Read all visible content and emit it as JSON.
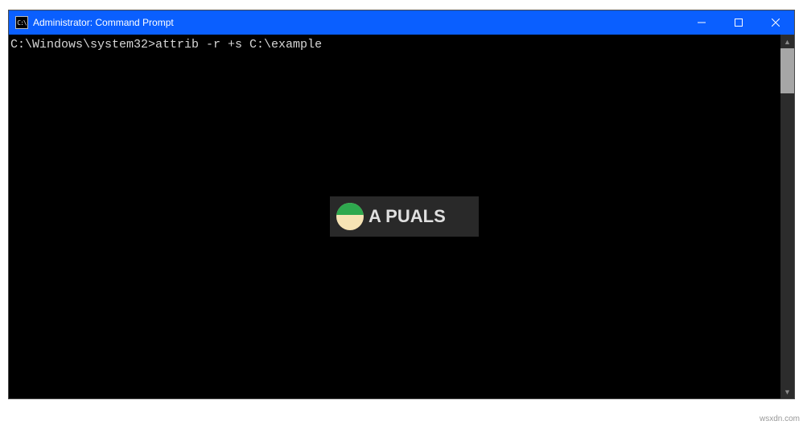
{
  "window": {
    "title": "Administrator: Command Prompt",
    "icon_label": "cmd-icon"
  },
  "terminal": {
    "prompt": "C:\\Windows\\system32>",
    "command": "attrib -r +s C:\\example"
  },
  "watermark": {
    "brand_text": "A  PUALS",
    "url": "wsxdn.com"
  },
  "controls": {
    "minimize": "minimize-button",
    "maximize": "maximize-button",
    "close": "close-button"
  }
}
